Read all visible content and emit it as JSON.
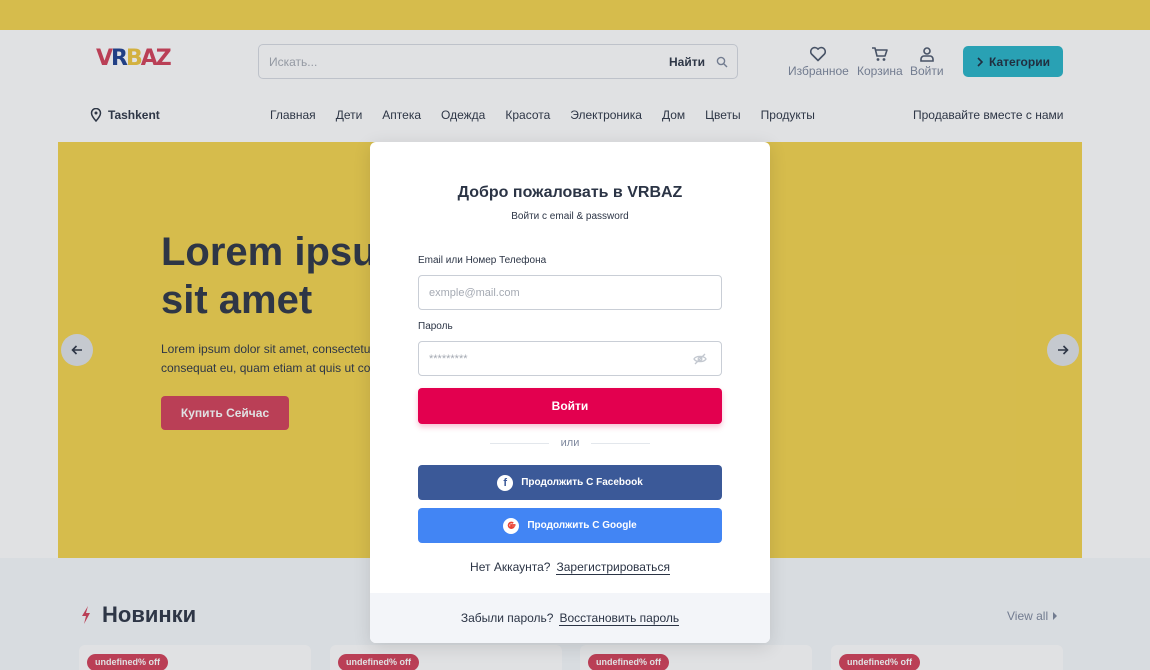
{
  "brand": {
    "logo_v": "V",
    "logo_r": "R",
    "logo_b": "B",
    "logo_az": "AZ"
  },
  "header": {
    "search": {
      "placeholder": "Искать...",
      "button": "Найти"
    },
    "favorites": "Избранное",
    "cart": "Корзина",
    "login": "Войти",
    "categories": "Категории"
  },
  "nav": {
    "location": "Tashkent",
    "items": [
      "Главная",
      "Дети",
      "Аптека",
      "Одежда",
      "Красота",
      "Электроника",
      "Дом",
      "Цветы",
      "Продукты"
    ],
    "sell": "Продавайте вместе с нами"
  },
  "hero": {
    "title_line1": "Lorem ipsu",
    "title_line2": "sit amet",
    "text_line1": "Lorem ipsum dolor sit amet, consectetur",
    "text_line2": "consequat eu, quam etiam at quis ut cor",
    "button": "Купить Сейчас"
  },
  "section": {
    "title": "Новинки",
    "view_all": "View all",
    "badges": [
      "undefined% off",
      "undefined% off",
      "undefined% off",
      "undefined% off"
    ]
  },
  "modal": {
    "title": "Добро пожаловать в VRBAZ",
    "subtitle": "Войти с email & password",
    "email_label": "Email или Номер Телефона",
    "email_placeholder": "exmple@mail.com",
    "password_label": "Пароль",
    "password_placeholder": "*********",
    "login_button": "Войти",
    "or": "или",
    "facebook": "Продолжить С Facebook",
    "google": "Продолжить С Google",
    "no_account": "Нет Аккаунта?",
    "register": "Зарегистрироваться",
    "forgot": "Забыли пароль?",
    "restore": "Восстановить пароль"
  },
  "colors": {
    "primary": "#e3004f",
    "banner": "#f3d34c",
    "categories_btn": "#26b3c7",
    "facebook": "#3b5998",
    "google": "#4285f4"
  }
}
